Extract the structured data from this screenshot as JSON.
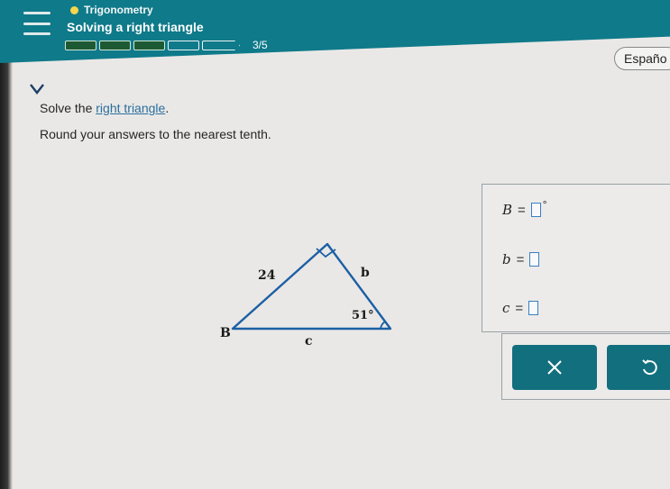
{
  "header": {
    "topic": "Trigonometry",
    "title": "Solving a right triangle",
    "progress_text": "3/5",
    "progress": {
      "completed": 3,
      "total": 5
    },
    "language_button": "Españo"
  },
  "problem": {
    "prompt_prefix": "Solve the ",
    "prompt_link": "right triangle",
    "prompt_suffix": ".",
    "instruction": "Round your answers to the nearest tenth."
  },
  "diagram": {
    "label_side": "24",
    "label_b": "b",
    "label_angle": "51°",
    "label_B": "B",
    "label_c": "c"
  },
  "answers": [
    {
      "var": "B",
      "eq": "=",
      "unit": "°"
    },
    {
      "var": "b",
      "eq": "=",
      "unit": ""
    },
    {
      "var": "c",
      "eq": "=",
      "unit": ""
    }
  ],
  "tools": {
    "clear_icon": "x-icon",
    "undo_icon": "undo-icon"
  },
  "colors": {
    "header": "#0f7a8a",
    "progress_done": "#1d5a34",
    "link": "#2c6f9e",
    "input_border": "#3a7fc1",
    "tool_button": "#126f7e"
  }
}
